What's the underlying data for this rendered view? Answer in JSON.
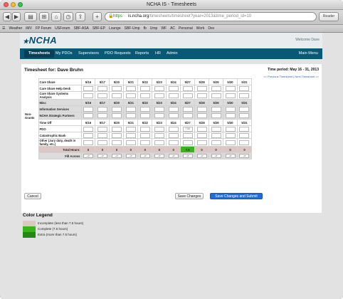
{
  "window": {
    "title": "NCHA IS - Timesheets"
  },
  "toolbar": {
    "url_host": "is.ncha.org",
    "url_path": "/timesheets/timesheet?year=2013&time_period_id=10",
    "url_scheme": "https",
    "reader_label": "Reader"
  },
  "bookmarks": [
    "Weather",
    "iMV",
    "FP Forum",
    "USForum",
    "SBF-ASA",
    "SBF-EP",
    "Lounge",
    "SBF-Ump",
    "fb",
    "Ump",
    "WF",
    "AC",
    "Personal",
    "Work",
    "Dev"
  ],
  "site": {
    "logo_text": "NCHA",
    "welcome": "Welcome Dave"
  },
  "nav": {
    "items": [
      "Timesheets",
      "My PDOs",
      "Supervisors",
      "PDO Requests",
      "Reports",
      "HR",
      "Admin"
    ],
    "main_menu": "Main Menu"
  },
  "timesheet": {
    "title": "Timesheet for: Dave Bruhn",
    "period": "Time period: May 16 - 31, 2013",
    "prev_link": "<< Previous Timesheet",
    "separator": "|",
    "next_link": "Next Timesheet >>",
    "dates": [
      "5/16",
      "5/17",
      "5/20",
      "5/21",
      "5/22",
      "5/23",
      "5/24",
      "5/27",
      "5/28",
      "5/29",
      "5/30",
      "5/31"
    ],
    "group_label": "Non-Grants",
    "sections": [
      {
        "label": "Care Share",
        "rows": [
          "Care Share Help Desk",
          "Care Share Systems Analysis"
        ]
      },
      {
        "label": "Misc",
        "rows": [
          "Information Services",
          "NCHA Strategic Partners"
        ]
      },
      {
        "label": "Time Off",
        "rows": [
          "PDO",
          "Catastrophic Bank",
          "Other (Jury duty, death in family, etc.)"
        ]
      }
    ],
    "pdo_values": [
      "",
      "",
      "",
      "",
      "",
      "",
      "",
      "7.50",
      "",
      "",
      "",
      ""
    ],
    "totals_label": "Total Hours:",
    "totals": [
      "0",
      "0",
      "0",
      "0",
      "0",
      "0",
      "0",
      "7.5",
      "0",
      "0",
      "0",
      "0"
    ],
    "fill_label": "Fill Across",
    "fill_button": "->",
    "cancel": "Cancel",
    "save": "Save Changes",
    "save_submit": "Save Changes and Submit"
  },
  "legend": {
    "title": "Color Legend",
    "items": [
      {
        "label": "Incomplete (less than 7.5 hours)",
        "color": "#ddc7c5"
      },
      {
        "label": "Complete (7.5 hours)",
        "color": "#37b519"
      },
      {
        "label": "Extra (more than 7.5 hours)",
        "color": "#1f8a10"
      }
    ]
  },
  "colors": {
    "nav": "#0a5877",
    "complete": "#37b519",
    "incomplete": "#ddc7c5",
    "submit": "#1e6dd6"
  }
}
